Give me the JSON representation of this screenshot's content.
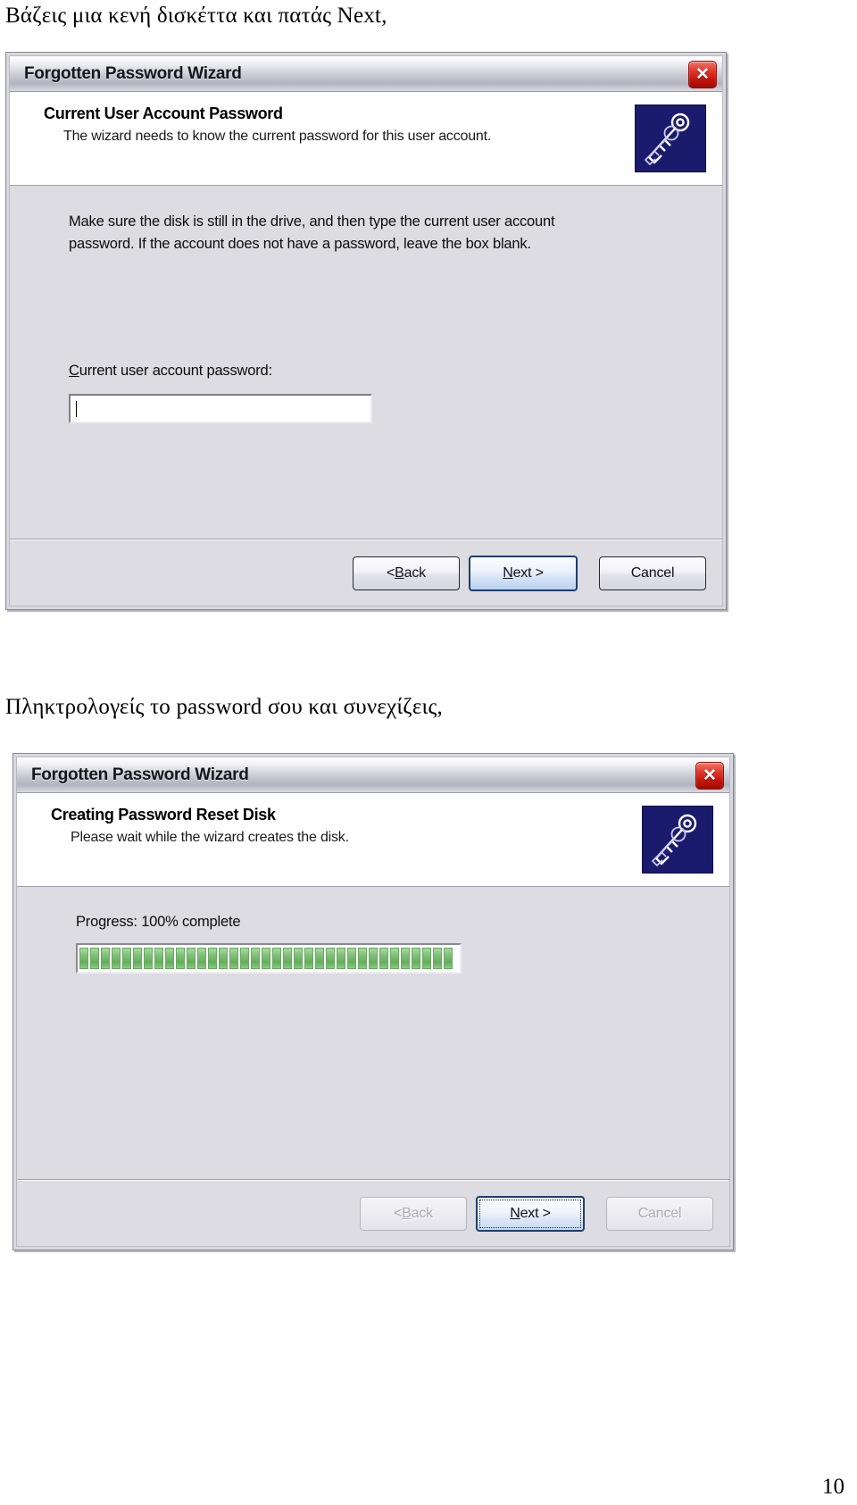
{
  "document": {
    "caption_1": "Βάζεις μια κενή δισκέττα και πατάς Next,",
    "caption_2": "Πληκτρολογείς το password σου και συνεχίζεις,",
    "page_number": "10"
  },
  "dialog_1": {
    "title": "Forgotten Password Wizard",
    "close_glyph": "✕",
    "header_title": "Current User Account Password",
    "header_subtitle": "The wizard needs to know the current password for this user account.",
    "body_paragraph": "Make sure the disk is still in the drive, and then type the current user account password. If the account does not have a password, leave the box blank.",
    "field_label_prefix": "C",
    "field_label_rest": "urrent user account password:",
    "password_value": "",
    "buttons": {
      "back_prefix": "< ",
      "back_accel": "B",
      "back_rest": "ack",
      "next_accel": "N",
      "next_rest": "ext >",
      "cancel": "Cancel"
    }
  },
  "dialog_2": {
    "title": "Forgotten Password Wizard",
    "close_glyph": "✕",
    "header_title": "Creating Password Reset Disk",
    "header_subtitle": "Please wait while the wizard creates the disk.",
    "progress_label": "Progress: 100% complete",
    "progress_percent": 100,
    "progress_segments": 35,
    "buttons": {
      "back_prefix": "< ",
      "back_accel": "B",
      "back_rest": "ack",
      "next_accel": "N",
      "next_rest": "ext >",
      "cancel": "Cancel"
    }
  },
  "colors": {
    "key_icon_background": "#1b1b6e",
    "progress_green": "#7fc077",
    "close_red": "#c4150c",
    "dialog_face": "#dcdce2"
  },
  "icons": {
    "key": "key-icon",
    "close": "close-icon"
  }
}
